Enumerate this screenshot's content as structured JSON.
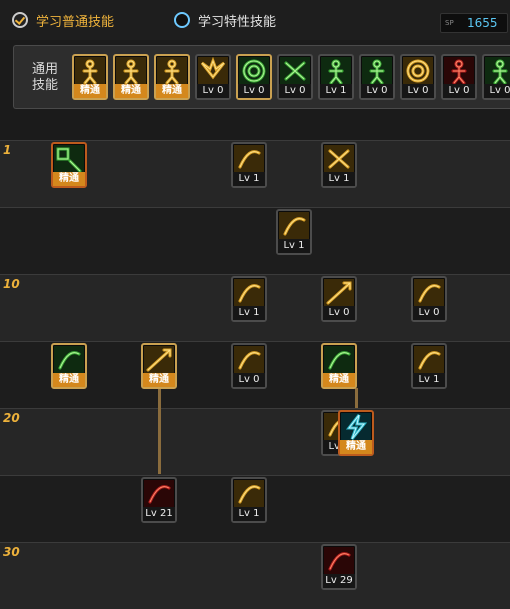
{
  "tabs": [
    {
      "label": "学习普通技能",
      "active": true
    },
    {
      "label": "学习特性技能",
      "active": false
    }
  ],
  "sp": {
    "tag": "SP",
    "value": "1655"
  },
  "common": {
    "label": "通用\n技能",
    "skills": [
      {
        "icon": "sitting-figure-icon",
        "label": "精通",
        "style": "master",
        "border": "gold"
      },
      {
        "icon": "kneeling-figure-icon",
        "label": "精通",
        "style": "master",
        "border": "gold"
      },
      {
        "icon": "running-figure-icon",
        "label": "精通",
        "style": "master",
        "border": "gold"
      },
      {
        "icon": "wings-icon",
        "label": "Lv 0",
        "style": "plain",
        "border": "gray"
      },
      {
        "icon": "target-icon",
        "label": "Lv 0",
        "style": "plain",
        "border": "gold"
      },
      {
        "icon": "crosshair-icon",
        "label": "Lv 0",
        "style": "plain",
        "border": "gray"
      },
      {
        "icon": "figure-burst-icon",
        "label": "Lv 1",
        "style": "plain",
        "border": "gray"
      },
      {
        "icon": "figure-guard-icon",
        "label": "Lv 0",
        "style": "plain",
        "border": "gray"
      },
      {
        "icon": "eye-icon",
        "label": "Lv 0",
        "style": "plain",
        "border": "gray"
      },
      {
        "icon": "armored-figure-icon",
        "label": "Lv 0",
        "style": "plain",
        "border": "gray"
      },
      {
        "icon": "green-figure-icon",
        "label": "Lv 0",
        "style": "plain",
        "border": "gray"
      }
    ]
  },
  "level_marks": [
    {
      "label": "1",
      "row": 0
    },
    {
      "label": "10",
      "row": 2
    },
    {
      "label": "20",
      "row": 4
    },
    {
      "label": "30",
      "row": 6
    }
  ],
  "tree_skills": [
    {
      "row": 0,
      "col": 0,
      "icon": "base-skill-icon",
      "label": "精通",
      "style": "master",
      "border": "orange"
    },
    {
      "row": 0,
      "col": 2,
      "icon": "slash-icon",
      "label": "Lv 1",
      "style": "plain",
      "border": "gray"
    },
    {
      "row": 0,
      "col": 3,
      "icon": "cross-slash-icon",
      "label": "Lv 1",
      "style": "plain",
      "border": "gray"
    },
    {
      "row": 1,
      "col": 2.5,
      "icon": "bow-icon",
      "label": "Lv 1",
      "style": "plain",
      "border": "gray"
    },
    {
      "row": 2,
      "col": 2,
      "icon": "crescent-icon",
      "label": "Lv 1",
      "style": "plain",
      "border": "gray"
    },
    {
      "row": 2,
      "col": 3,
      "icon": "thrust-icon",
      "label": "Lv 0",
      "style": "plain",
      "border": "gray"
    },
    {
      "row": 2,
      "col": 4,
      "icon": "leap-strike-icon",
      "label": "Lv 0",
      "style": "plain",
      "border": "gray"
    },
    {
      "row": 3,
      "col": 0,
      "icon": "green-slash-icon",
      "label": "精通",
      "style": "master",
      "border": "gold"
    },
    {
      "row": 3,
      "col": 1,
      "icon": "spear-icon",
      "label": "精通",
      "style": "master",
      "border": "gold"
    },
    {
      "row": 3,
      "col": 2,
      "icon": "wave-icon",
      "label": "Lv 0",
      "style": "plain",
      "border": "gray"
    },
    {
      "row": 3,
      "col": 3,
      "icon": "green-burst-icon",
      "label": "精通",
      "style": "master",
      "border": "gold"
    },
    {
      "row": 3,
      "col": 4,
      "icon": "swirl-icon",
      "label": "Lv 1",
      "style": "plain",
      "border": "gray"
    },
    {
      "row": 4,
      "col": 3,
      "icon": "arc-slash-icon",
      "label": "Lv 1",
      "style": "plain",
      "border": "gray"
    },
    {
      "row": 4,
      "col": 3.5,
      "icon": "lightning-icon",
      "label": "精通",
      "style": "master",
      "border": "orange"
    },
    {
      "row": 5,
      "col": 1,
      "icon": "red-slash-icon",
      "label": "Lv 21",
      "style": "plain",
      "border": "gray"
    },
    {
      "row": 5,
      "col": 2,
      "icon": "twin-arc-icon",
      "label": "Lv 1",
      "style": "plain",
      "border": "gray"
    },
    {
      "row": 6,
      "col": 3,
      "icon": "red-crescent-icon",
      "label": "Lv 29",
      "style": "plain",
      "border": "gray"
    }
  ],
  "colors": {
    "accent": "#f0b43c",
    "sp": "#5bc6f2",
    "master_label": "#d4881d",
    "level_mark": "#ecb13b"
  }
}
